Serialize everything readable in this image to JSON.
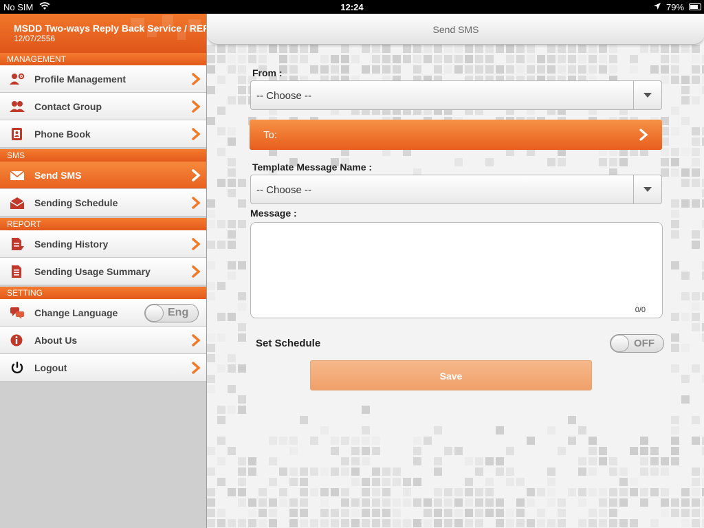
{
  "status_bar": {
    "carrier": "No SIM",
    "time": "12:24",
    "battery": "79%",
    "battery_level": 0.79,
    "icons": [
      "wifi-icon",
      "location-arrow-icon",
      "battery-icon"
    ]
  },
  "sidebar": {
    "title": "MSDD Two-ways Reply Back Service / REPLY",
    "date": "12/07/2556",
    "sections": {
      "management": "MANAGEMENT",
      "sms": "SMS",
      "report": "REPORT",
      "setting": "SETTING"
    },
    "items": [
      {
        "label": "Profile Management",
        "icon": "profile-gear-icon"
      },
      {
        "label": "Contact Group",
        "icon": "group-icon"
      },
      {
        "label": "Phone Book",
        "icon": "phonebook-icon"
      },
      {
        "label": "Send SMS",
        "icon": "envelope-icon",
        "active": true
      },
      {
        "label": "Sending Schedule",
        "icon": "envelope-open-icon"
      },
      {
        "label": "Sending History",
        "icon": "document-history-icon"
      },
      {
        "label": "Sending Usage Summary",
        "icon": "document-summary-icon"
      },
      {
        "label": "Change Language",
        "icon": "speech-bubbles-icon",
        "toggle": "Eng"
      },
      {
        "label": "About Us",
        "icon": "info-icon"
      },
      {
        "label": "Logout",
        "icon": "power-icon"
      }
    ]
  },
  "main": {
    "title": "Send SMS",
    "from_label": "From :",
    "from_value": "-- Choose --",
    "to_label": "To:",
    "template_label": "Template Message Name :",
    "template_value": "-- Choose --",
    "message_label": "Message :",
    "message_counter": "0/0",
    "schedule_label": "Set Schedule",
    "schedule_toggle": "OFF",
    "save_label": "Save"
  },
  "colors": {
    "accent": "#e8601f",
    "accent_light": "#f68a3c",
    "save_button": "#f3ab78"
  }
}
